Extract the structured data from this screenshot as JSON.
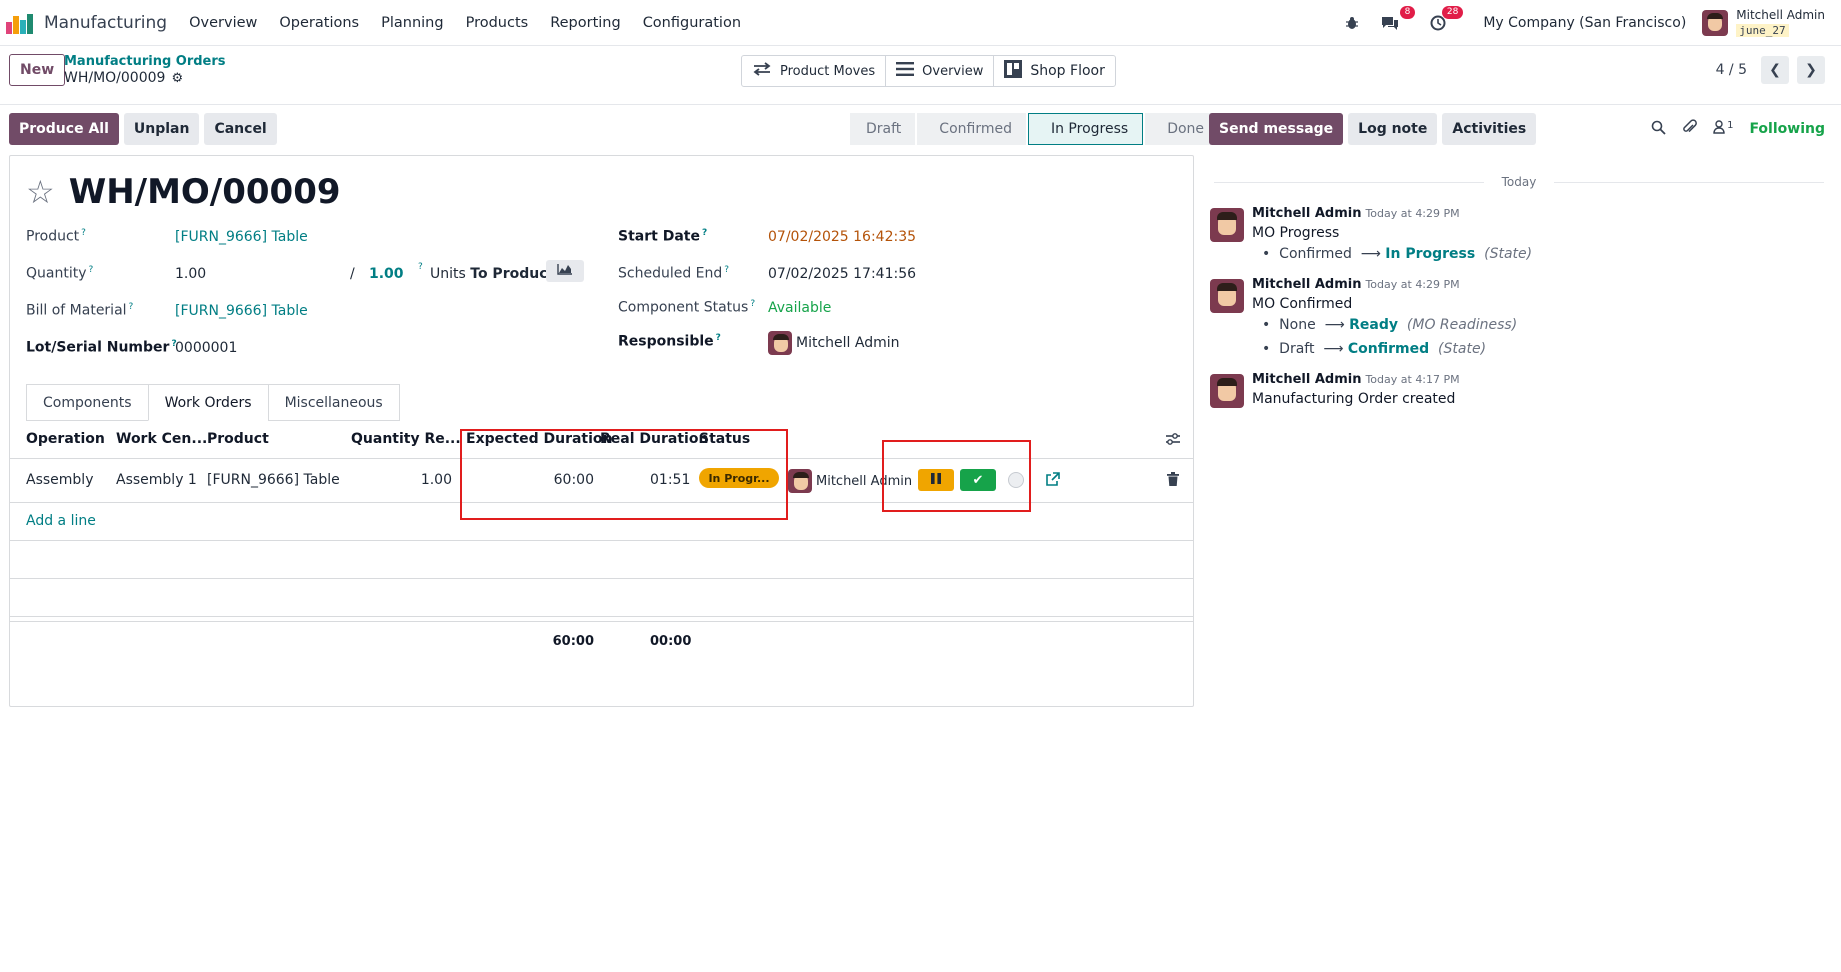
{
  "navbar": {
    "app_name": "Manufacturing",
    "menu": [
      "Overview",
      "Operations",
      "Planning",
      "Products",
      "Reporting",
      "Configuration"
    ],
    "chat_badge": "8",
    "activity_badge": "28",
    "company": "My Company (San Francisco)",
    "user_name": "Mitchell Admin",
    "db_name": "june_27"
  },
  "control": {
    "new_label": "New",
    "breadcrumb_parent": "Manufacturing Orders",
    "breadcrumb_current": "WH/MO/00009",
    "smart_buttons": [
      "Product Moves",
      "Overview",
      "Shop Floor"
    ],
    "pager": "4 / 5"
  },
  "actions": {
    "produce_all": "Produce All",
    "unplan": "Unplan",
    "cancel": "Cancel"
  },
  "statusbar": [
    "Draft",
    "Confirmed",
    "In Progress",
    "Done"
  ],
  "statusbar_active": "In Progress",
  "form": {
    "title": "WH/MO/00009",
    "product_label": "Product",
    "product_value": "[FURN_9666] Table",
    "quantity_label": "Quantity",
    "quantity_value": "1.00",
    "quantity_sep": "/",
    "quantity_target": "1.00",
    "units_label": "Units",
    "to_produce_label": "To Produce",
    "bom_label": "Bill of Material",
    "bom_value": "[FURN_9666] Table",
    "lot_label": "Lot/Serial Number",
    "lot_value": "0000001",
    "start_date_label": "Start Date",
    "start_date_value": "07/02/2025 16:42:35",
    "scheduled_end_label": "Scheduled End",
    "scheduled_end_value": "07/02/2025 17:41:56",
    "component_status_label": "Component Status",
    "component_status_value": "Available",
    "responsible_label": "Responsible",
    "responsible_value": "Mitchell Admin",
    "help_mark": "?"
  },
  "tabs": [
    "Components",
    "Work Orders",
    "Miscellaneous"
  ],
  "active_tab": "Work Orders",
  "work_orders": {
    "columns": [
      "Operation",
      "Work Cen...",
      "Product",
      "Quantity Re...",
      "Expected Duration",
      "Real Duration",
      "Status"
    ],
    "rows": [
      {
        "operation": "Assembly",
        "work_center": "Assembly 1",
        "product": "[FURN_9666] Table",
        "quantity": "1.00",
        "expected_duration": "60:00",
        "real_duration": "01:51",
        "status": "In Progr...",
        "user": "Mitchell Admin"
      }
    ],
    "add_line": "Add a line",
    "total_expected": "60:00",
    "total_real": "00:00"
  },
  "chatter": {
    "send_message": "Send message",
    "log_note": "Log note",
    "activities": "Activities",
    "followers_count": "1",
    "following": "Following",
    "date_separator": "Today",
    "messages": [
      {
        "author": "Mitchell Admin",
        "time": "Today at 4:29 PM",
        "body": "MO Progress",
        "changes": [
          {
            "old": "Confirmed",
            "new": "In Progress",
            "field": "(State)"
          }
        ]
      },
      {
        "author": "Mitchell Admin",
        "time": "Today at 4:29 PM",
        "body": "MO Confirmed",
        "changes": [
          {
            "old": "None",
            "new": "Ready",
            "field": "(MO Readiness)"
          },
          {
            "old": "Draft",
            "new": "Confirmed",
            "field": "(State)"
          }
        ]
      },
      {
        "author": "Mitchell Admin",
        "time": "Today at 4:17 PM",
        "body": "Manufacturing Order created",
        "changes": []
      }
    ]
  },
  "colors": {
    "primary": "#714b67",
    "link": "#017e84",
    "in_progress": "#f0a500",
    "done": "#16a34a",
    "highlight_box": "#e11d1d"
  }
}
